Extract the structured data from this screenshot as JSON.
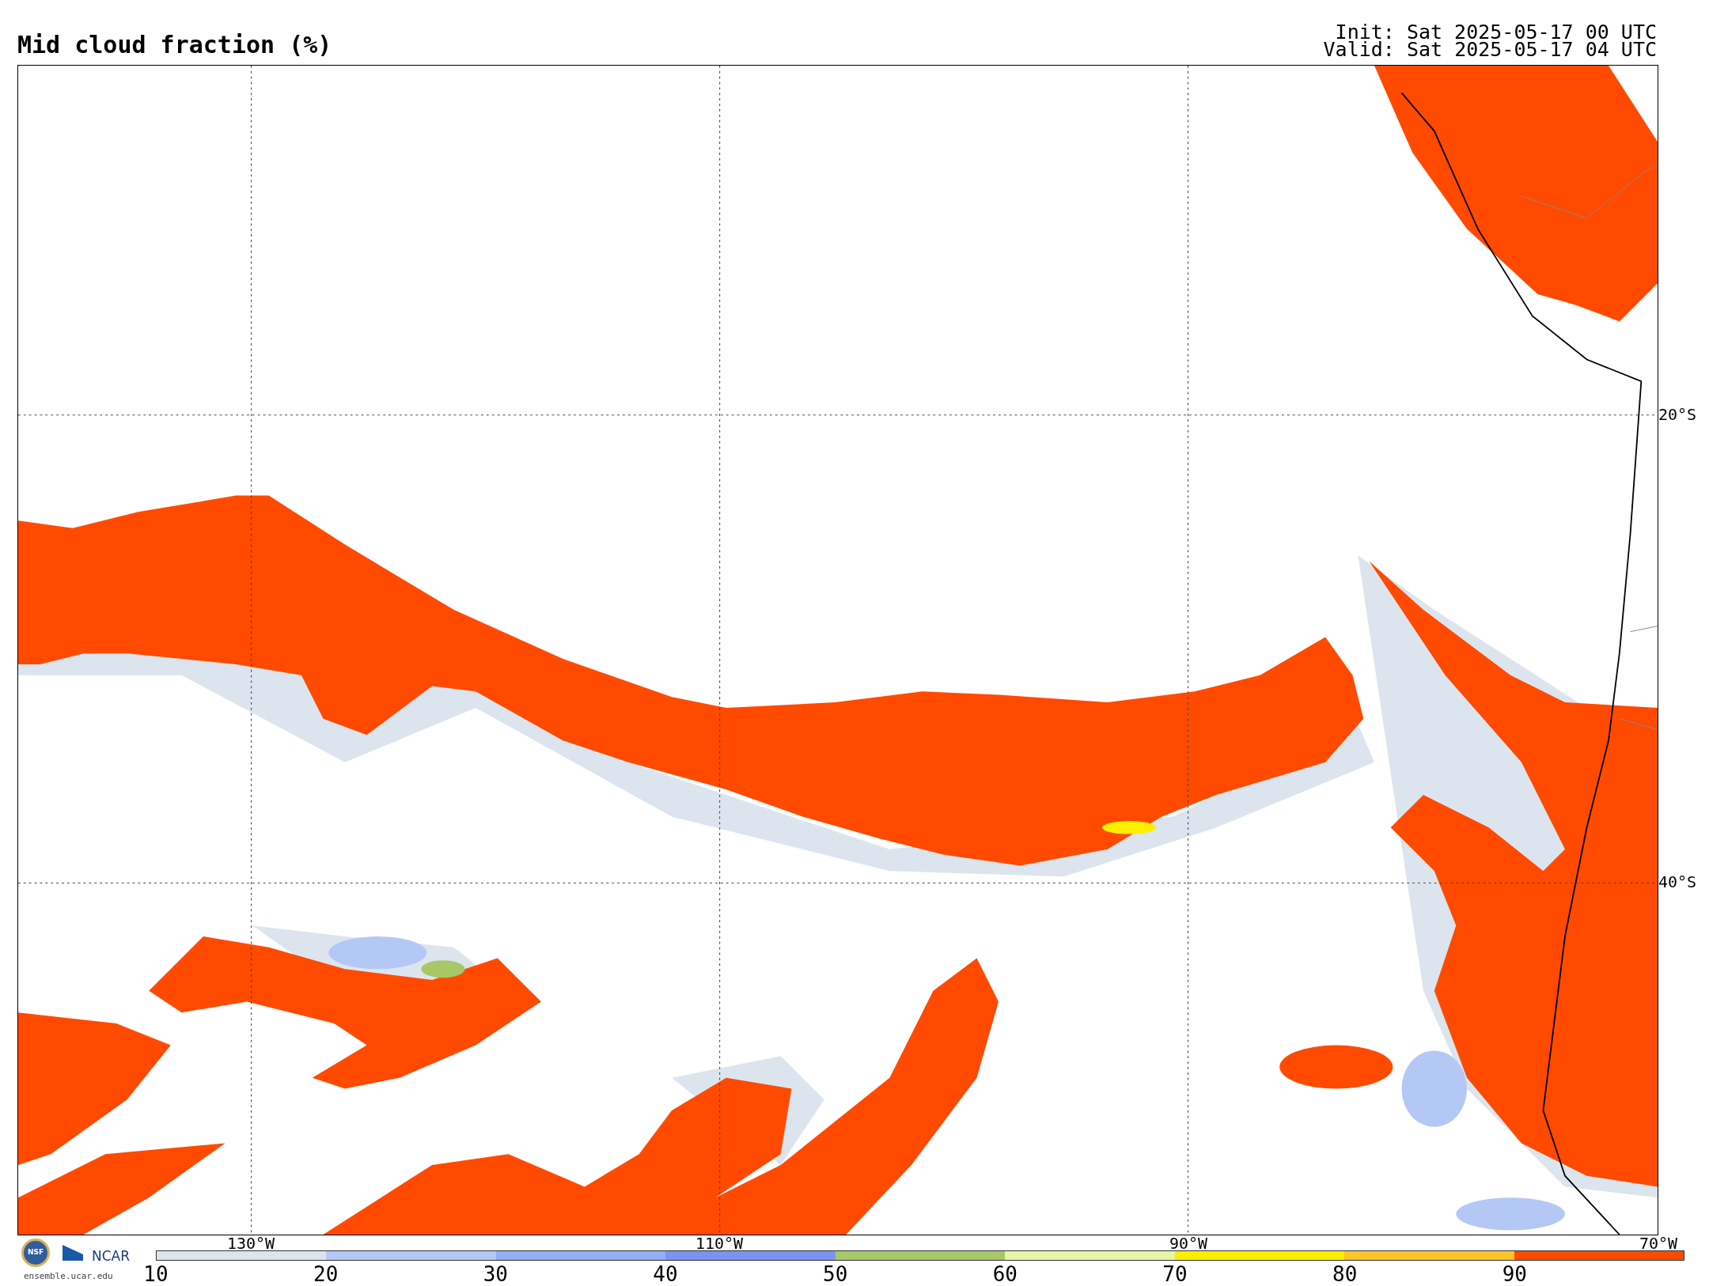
{
  "title": "Mid cloud fraction (%)",
  "init": "Init: Sat 2025-05-17 00 UTC",
  "valid": "Valid: Sat 2025-05-17 04 UTC",
  "lat_labels": [
    {
      "label": "20°S"
    },
    {
      "label": "40°S"
    }
  ],
  "lon_labels": [
    {
      "label": "130°W"
    },
    {
      "label": "110°W"
    },
    {
      "label": "90°W"
    },
    {
      "label": "70°W"
    }
  ],
  "logo": {
    "nsf": "NSF",
    "ncar": "NCAR",
    "site": "ensemble.ucar.edu"
  },
  "colorbar": {
    "ticks": [
      "10",
      "20",
      "30",
      "40",
      "50",
      "60",
      "70",
      "80",
      "90"
    ],
    "bins": [
      {
        "color": "#dce5ee"
      },
      {
        "color": "#b4c8f5"
      },
      {
        "color": "#92aff5"
      },
      {
        "color": "#7b93f2"
      },
      {
        "color": "#a6c866"
      },
      {
        "color": "#e6f5a6"
      },
      {
        "color": "#ffee00"
      },
      {
        "color": "#ffc425"
      },
      {
        "color": "#ff4a00"
      }
    ]
  }
}
